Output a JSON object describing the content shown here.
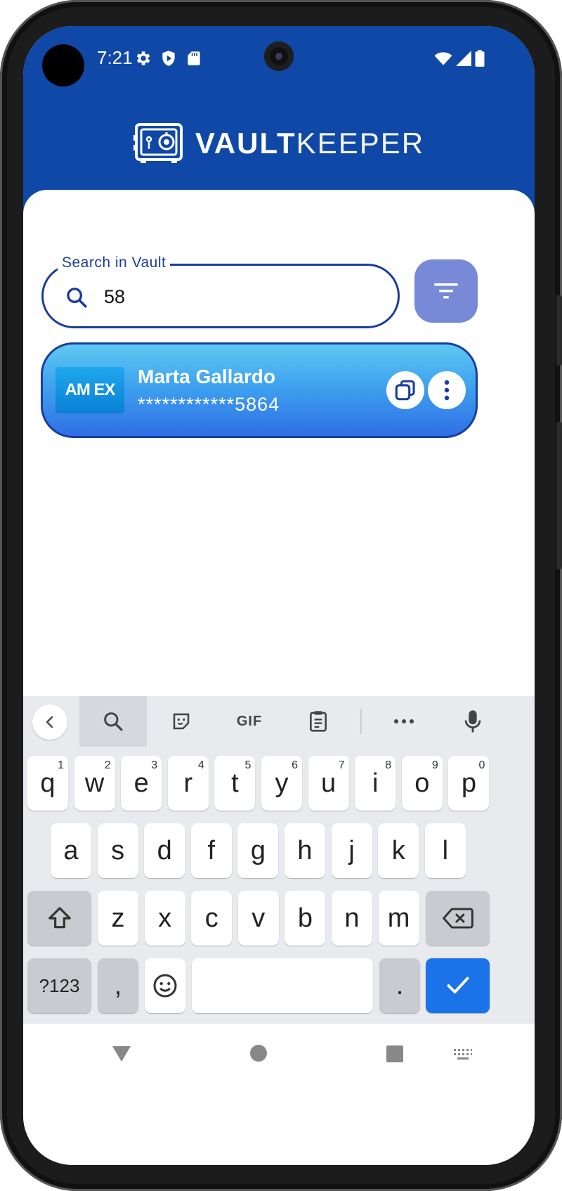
{
  "status_bar": {
    "time": "7:21",
    "left_icons": [
      "settings-icon",
      "shield-play-icon",
      "sd-card-icon"
    ],
    "right_icons": [
      "wifi-icon",
      "signal-icon",
      "battery-icon"
    ]
  },
  "header": {
    "brand_bold": "VAULT",
    "brand_light": "KEEPER",
    "logo_icon": "vault-safe-icon",
    "background_color": "#0f48a6"
  },
  "search": {
    "label": "Search in Vault",
    "value": "58",
    "icon": "search-icon"
  },
  "filter_button": {
    "icon": "filter-icon",
    "color": "#7889d8"
  },
  "results": [
    {
      "brand": "AM EX",
      "name": "Marta Gallardo",
      "masked_number": "************5864",
      "actions": [
        "copy-icon",
        "more-vert-icon"
      ]
    }
  ],
  "keyboard": {
    "toolbar": [
      "back-chevron-icon",
      "search-icon",
      "sticker-icon",
      "GIF",
      "clipboard-icon",
      "more-horiz-icon",
      "mic-icon"
    ],
    "row1": [
      {
        "k": "q",
        "h": "1"
      },
      {
        "k": "w",
        "h": "2"
      },
      {
        "k": "e",
        "h": "3"
      },
      {
        "k": "r",
        "h": "4"
      },
      {
        "k": "t",
        "h": "5"
      },
      {
        "k": "y",
        "h": "6"
      },
      {
        "k": "u",
        "h": "7"
      },
      {
        "k": "i",
        "h": "8"
      },
      {
        "k": "o",
        "h": "9"
      },
      {
        "k": "p",
        "h": "0"
      }
    ],
    "row2": [
      "a",
      "s",
      "d",
      "f",
      "g",
      "h",
      "j",
      "k",
      "l"
    ],
    "row3": [
      "z",
      "x",
      "c",
      "v",
      "b",
      "n",
      "m"
    ],
    "symbols_label": "?123",
    "comma": ",",
    "period": ".",
    "enter_color": "#1a73e8"
  },
  "nav": [
    "back-triangle-icon",
    "home-circle-icon",
    "recents-square-icon",
    "keyboard-switch-icon"
  ]
}
